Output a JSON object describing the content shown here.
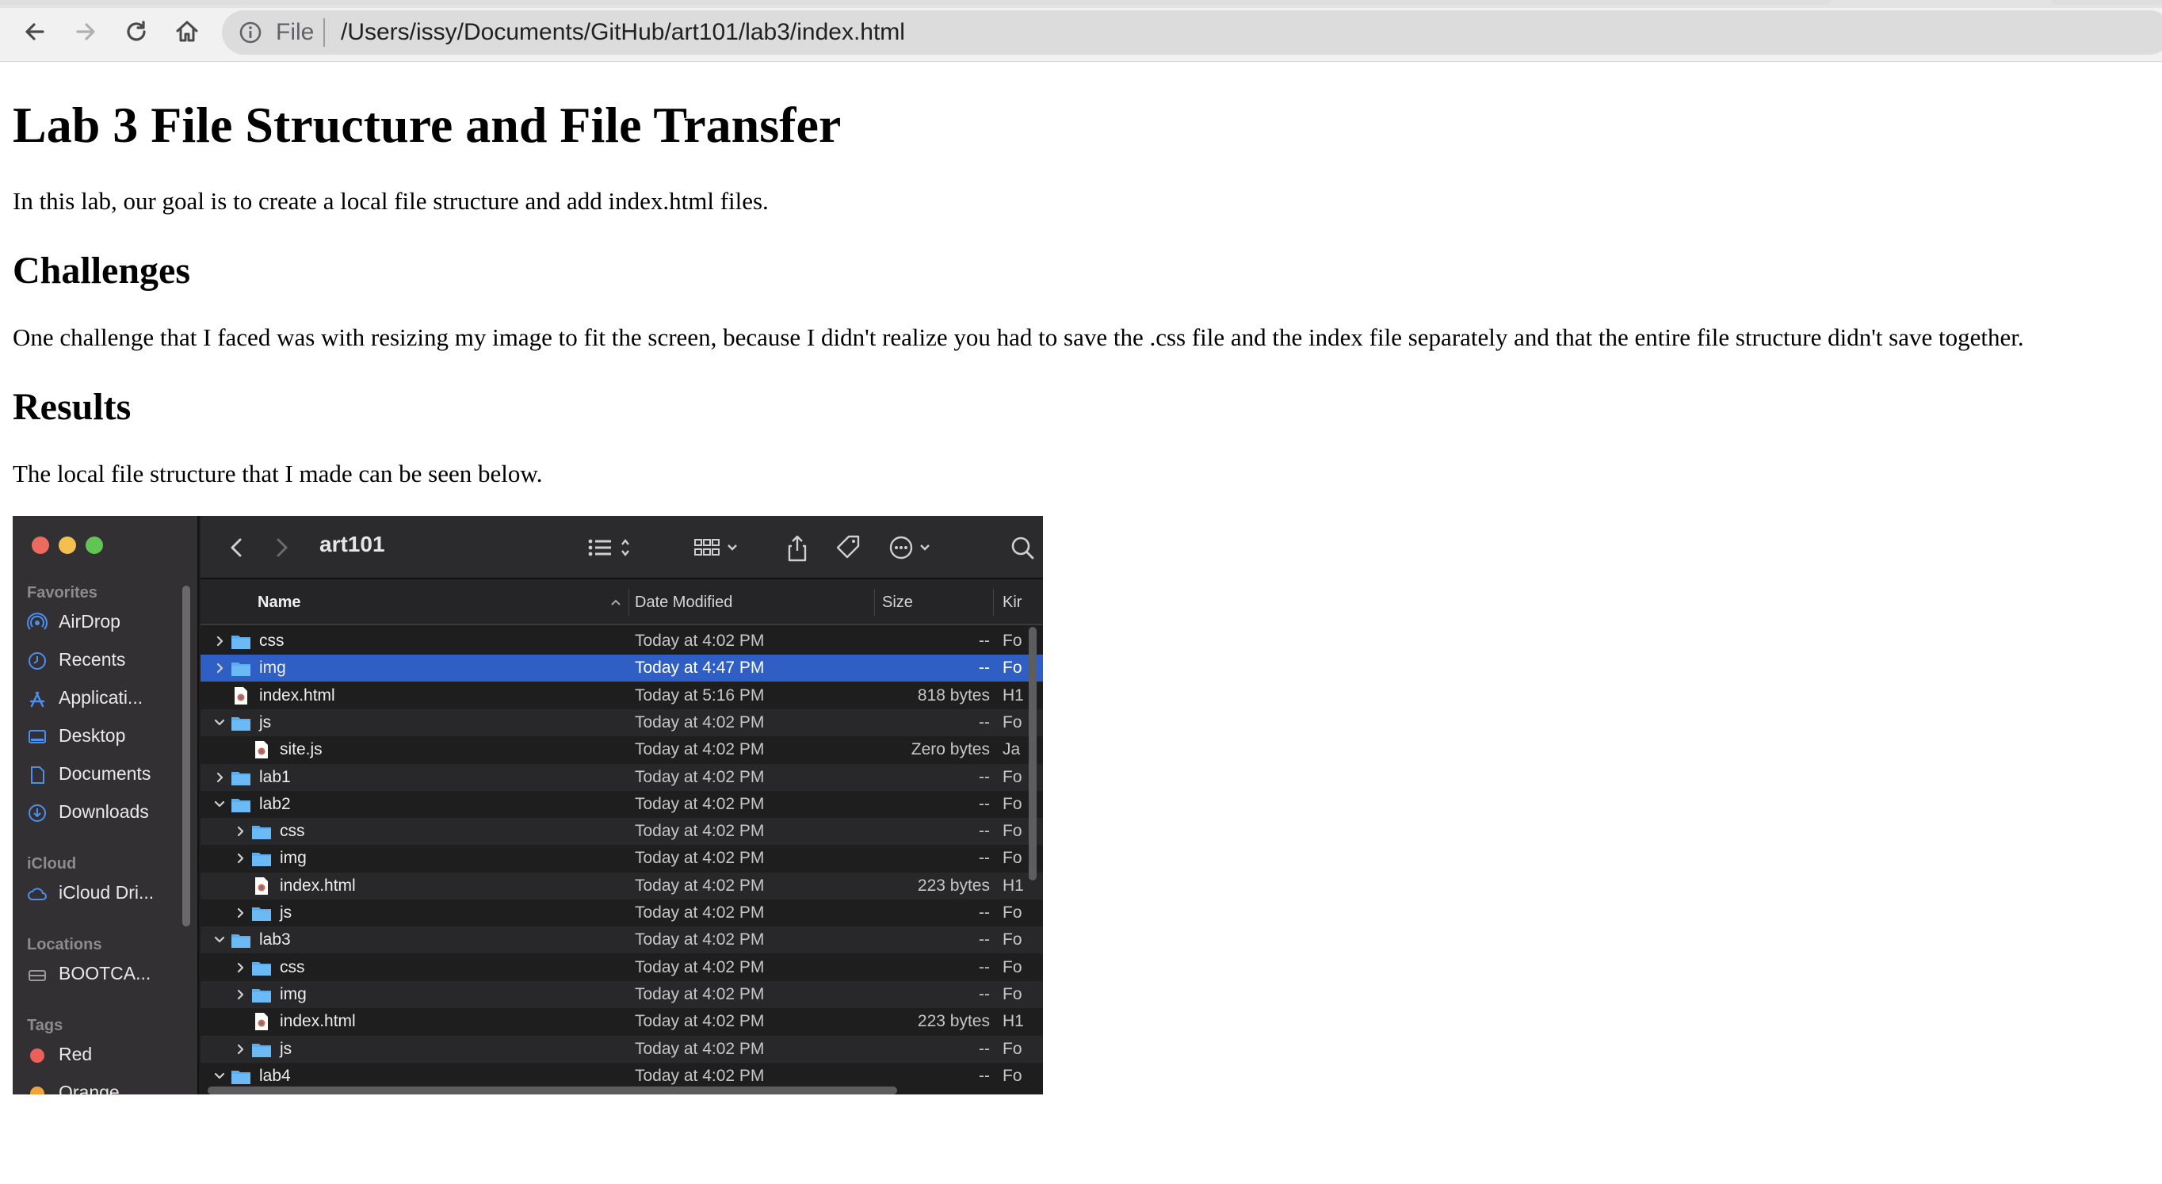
{
  "browser": {
    "url_scheme_label": "File",
    "url": "/Users/issy/Documents/GitHub/art101/lab3/index.html"
  },
  "page": {
    "title": "Lab 3 File Structure and File Transfer",
    "intro": "In this lab, our goal is to create a local file structure and add index.html files.",
    "challenges_heading": "Challenges",
    "challenges_text": "One challenge that I faced was with resizing my image to fit the screen, because I didn't realize you had to save the .css file and the index file separately and that the entire file structure didn't save together.",
    "results_heading": "Results",
    "results_text": "The local file structure that I made can be seen below."
  },
  "finder": {
    "window_title": "art101",
    "sidebar": {
      "favorites_label": "Favorites",
      "favorites": [
        "AirDrop",
        "Recents",
        "Applicati...",
        "Desktop",
        "Documents",
        "Downloads"
      ],
      "icloud_label": "iCloud",
      "icloud": [
        "iCloud Dri..."
      ],
      "locations_label": "Locations",
      "locations": [
        "BOOTCA..."
      ],
      "tags_label": "Tags",
      "tags": [
        "Red",
        "Orange"
      ]
    },
    "columns": {
      "name": "Name",
      "date": "Date Modified",
      "size": "Size",
      "kind": "Kir"
    },
    "rows": [
      {
        "name": "css",
        "type": "folder",
        "level": 0,
        "disclosure": "closed",
        "date": "Today at 4:02 PM",
        "size": "--",
        "kind": "Fo"
      },
      {
        "name": "img",
        "type": "folder",
        "level": 0,
        "disclosure": "closed",
        "date": "Today at 4:47 PM",
        "size": "--",
        "kind": "Fo",
        "selected": true
      },
      {
        "name": "index.html",
        "type": "file",
        "level": 0,
        "disclosure": "none",
        "date": "Today at 5:16 PM",
        "size": "818 bytes",
        "kind": "H1"
      },
      {
        "name": "js",
        "type": "folder",
        "level": 0,
        "disclosure": "open",
        "date": "Today at 4:02 PM",
        "size": "--",
        "kind": "Fo"
      },
      {
        "name": "site.js",
        "type": "file",
        "level": 1,
        "disclosure": "none",
        "date": "Today at 4:02 PM",
        "size": "Zero bytes",
        "kind": "Ja"
      },
      {
        "name": "lab1",
        "type": "folder",
        "level": 0,
        "disclosure": "closed",
        "date": "Today at 4:02 PM",
        "size": "--",
        "kind": "Fo"
      },
      {
        "name": "lab2",
        "type": "folder",
        "level": 0,
        "disclosure": "open",
        "date": "Today at 4:02 PM",
        "size": "--",
        "kind": "Fo"
      },
      {
        "name": "css",
        "type": "folder",
        "level": 1,
        "disclosure": "closed",
        "date": "Today at 4:02 PM",
        "size": "--",
        "kind": "Fo"
      },
      {
        "name": "img",
        "type": "folder",
        "level": 1,
        "disclosure": "closed",
        "date": "Today at 4:02 PM",
        "size": "--",
        "kind": "Fo"
      },
      {
        "name": "index.html",
        "type": "file",
        "level": 1,
        "disclosure": "none",
        "date": "Today at 4:02 PM",
        "size": "223 bytes",
        "kind": "H1"
      },
      {
        "name": "js",
        "type": "folder",
        "level": 1,
        "disclosure": "closed",
        "date": "Today at 4:02 PM",
        "size": "--",
        "kind": "Fo"
      },
      {
        "name": "lab3",
        "type": "folder",
        "level": 0,
        "disclosure": "open",
        "date": "Today at 4:02 PM",
        "size": "--",
        "kind": "Fo"
      },
      {
        "name": "css",
        "type": "folder",
        "level": 1,
        "disclosure": "closed",
        "date": "Today at 4:02 PM",
        "size": "--",
        "kind": "Fo"
      },
      {
        "name": "img",
        "type": "folder",
        "level": 1,
        "disclosure": "closed",
        "date": "Today at 4:02 PM",
        "size": "--",
        "kind": "Fo"
      },
      {
        "name": "index.html",
        "type": "file",
        "level": 1,
        "disclosure": "none",
        "date": "Today at 4:02 PM",
        "size": "223 bytes",
        "kind": "H1"
      },
      {
        "name": "js",
        "type": "folder",
        "level": 1,
        "disclosure": "closed",
        "date": "Today at 4:02 PM",
        "size": "--",
        "kind": "Fo"
      },
      {
        "name": "lab4",
        "type": "folder",
        "level": 0,
        "disclosure": "open",
        "date": "Today at 4:02 PM",
        "size": "--",
        "kind": "Fo"
      }
    ]
  },
  "colors": {
    "accent_selection": "#2f5ec4",
    "folder_blue": "#5aaef0",
    "traffic_red": "#ec6a5e",
    "traffic_yellow": "#f4bf4f",
    "traffic_green": "#61c554",
    "tag_red": "#ec5f5a",
    "tag_orange": "#f0a43a"
  }
}
